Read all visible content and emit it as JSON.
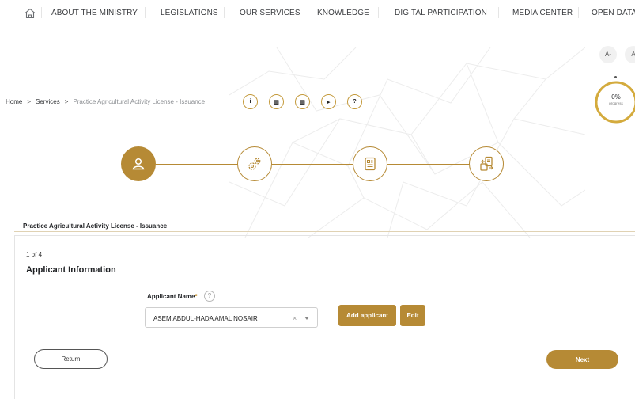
{
  "nav": {
    "items": [
      "ABOUT THE MINISTRY",
      "LEGISLATIONS",
      "OUR SERVICES",
      "KNOWLEDGE",
      "DIGITAL PARTICIPATION",
      "MEDIA CENTER",
      "OPEN DATA"
    ]
  },
  "font_size": {
    "decrease": "A-",
    "increase": "A"
  },
  "progress": {
    "value": "0%",
    "label": "progress",
    "fraction": 0
  },
  "breadcrumb": {
    "home": "Home",
    "services": "Services",
    "current": "Practice Agricultural Activity License - Issuance",
    "separator": ">"
  },
  "tools": [
    "i",
    "▥",
    "▥",
    "▸",
    "?"
  ],
  "stepper": {
    "current_step": 1,
    "steps": [
      "user-icon",
      "gears-icon",
      "document-icon",
      "document-exchange-icon"
    ]
  },
  "form": {
    "card_title": "Practice Agricultural Activity License - Issuance",
    "step_count": "1 of 4",
    "section_title": "Applicant Information",
    "applicant_label": "Applicant Name",
    "required_mark": "*",
    "help": "?",
    "applicant_value": "ASEM ABDUL-HADA AMAL NOSAIR",
    "clear": "×",
    "add_applicant": "Add applicant",
    "edit": "Edit"
  },
  "actions": {
    "return": "Return",
    "next": "Next"
  },
  "colors": {
    "accent": "#b68a35",
    "text": "#232528"
  }
}
